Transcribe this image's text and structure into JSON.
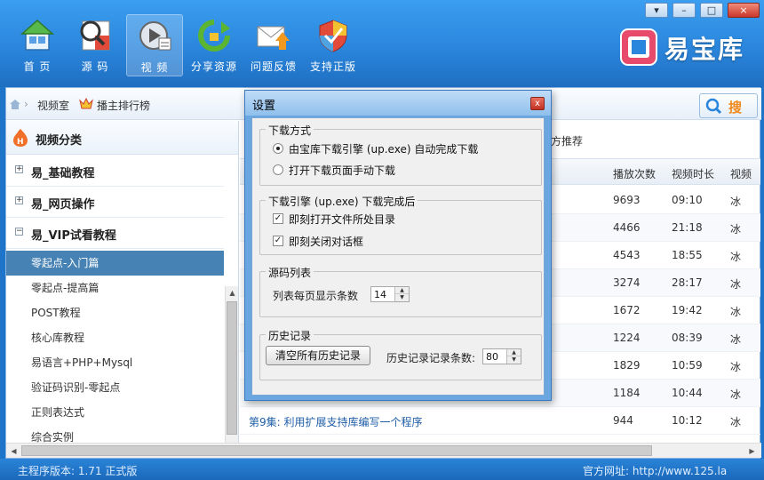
{
  "nav": {
    "items": [
      {
        "label": "首 页",
        "icon": "home-icon"
      },
      {
        "label": "源 码",
        "icon": "source-code-icon"
      },
      {
        "label": "视 频",
        "icon": "video-icon"
      },
      {
        "label": "分享资源",
        "icon": "share-icon"
      },
      {
        "label": "问题反馈",
        "icon": "feedback-mail-icon"
      },
      {
        "label": "支持正版",
        "icon": "shield-icon"
      }
    ],
    "active_index": 2
  },
  "window_controls": {
    "dropdown": "▾",
    "minimize": "–",
    "maximize": "□",
    "close": "×"
  },
  "logo": {
    "text": "易宝库"
  },
  "breadcrumb": {
    "item1": "视频室",
    "item2": "播主排行榜"
  },
  "search": {
    "label": "搜"
  },
  "sidebar": {
    "header": "视频分类",
    "categories": [
      {
        "label": "易_基础教程",
        "toggle": "+"
      },
      {
        "label": "易_网页操作",
        "toggle": "+"
      },
      {
        "label": "易_VIP试看教程",
        "toggle": "−"
      }
    ],
    "sub_items": [
      "零起点-入门篇",
      "零起点-提高篇",
      "POST教程",
      "核心库教程",
      "易语言+PHP+Mysql",
      "验证码识别-零起点",
      "正则表达式",
      "综合实例"
    ],
    "selected_index": 0
  },
  "main": {
    "recommend_tab": "方推荐",
    "columns": {
      "plays": "播放次数",
      "duration": "视频时长",
      "extra": "视频"
    },
    "rows": [
      {
        "title": "",
        "plays": "9693",
        "duration": "09:10",
        "extra": "冰"
      },
      {
        "title": "",
        "plays": "4466",
        "duration": "21:18",
        "extra": "冰"
      },
      {
        "title": "",
        "plays": "4543",
        "duration": "18:55",
        "extra": "冰"
      },
      {
        "title": "",
        "plays": "3274",
        "duration": "28:17",
        "extra": "冰"
      },
      {
        "title": "",
        "plays": "1672",
        "duration": "19:42",
        "extra": "冰"
      },
      {
        "title": "",
        "plays": "1224",
        "duration": "08:39",
        "extra": "冰"
      },
      {
        "title": "",
        "plays": "1829",
        "duration": "10:59",
        "extra": "冰"
      },
      {
        "title": "",
        "plays": "1184",
        "duration": "10:44",
        "extra": "冰"
      },
      {
        "title": "第9集: 利用扩展支持库编写一个程序",
        "plays": "944",
        "duration": "10:12",
        "extra": "冰"
      }
    ]
  },
  "status": {
    "version": "主程序版本: 1.71 正式版",
    "website": "官方网址: http://www.125.la"
  },
  "dialog": {
    "title": "设置",
    "close": "x",
    "download_mode": {
      "legend": "下载方式",
      "option1": "由宝库下载引擎 (up.exe) 自动完成下载",
      "option2": "打开下载页面手动下载",
      "selected": 1
    },
    "after_download": {
      "legend": "下载引擎 (up.exe) 下载完成后",
      "check1": "即刻打开文件所处目录",
      "check2": "即刻关闭对话框",
      "check1_checked": true,
      "check2_checked": true
    },
    "source_list": {
      "legend": "源码列表",
      "per_page_label": "列表每页显示条数",
      "per_page_value": "14"
    },
    "history": {
      "legend": "历史记录",
      "clear_button": "清空所有历史记录",
      "count_label": "历史记录记录条数:",
      "count_value": "80"
    }
  },
  "colors": {
    "header": "#2a86dc",
    "selection": "#4682b4",
    "dialog_frame": "#6aa7e0"
  }
}
